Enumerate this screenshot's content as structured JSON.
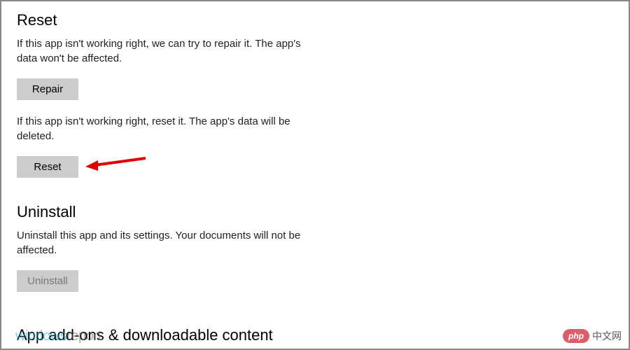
{
  "reset": {
    "heading": "Reset",
    "repair_desc": "If this app isn't working right, we can try to repair it. The app's data won't be affected.",
    "repair_btn": "Repair",
    "reset_desc": "If this app isn't working right, reset it. The app's data will be deleted.",
    "reset_btn": "Reset"
  },
  "uninstall": {
    "heading": "Uninstall",
    "desc": "Uninstall this app and its settings. Your documents will not be affected.",
    "btn": "Uninstall"
  },
  "addons": {
    "heading": "App add-ons & downloadable content"
  },
  "watermarks": {
    "left_a": "windows",
    "left_b": "report",
    "right_pill": "php",
    "right_text": "中文网"
  }
}
